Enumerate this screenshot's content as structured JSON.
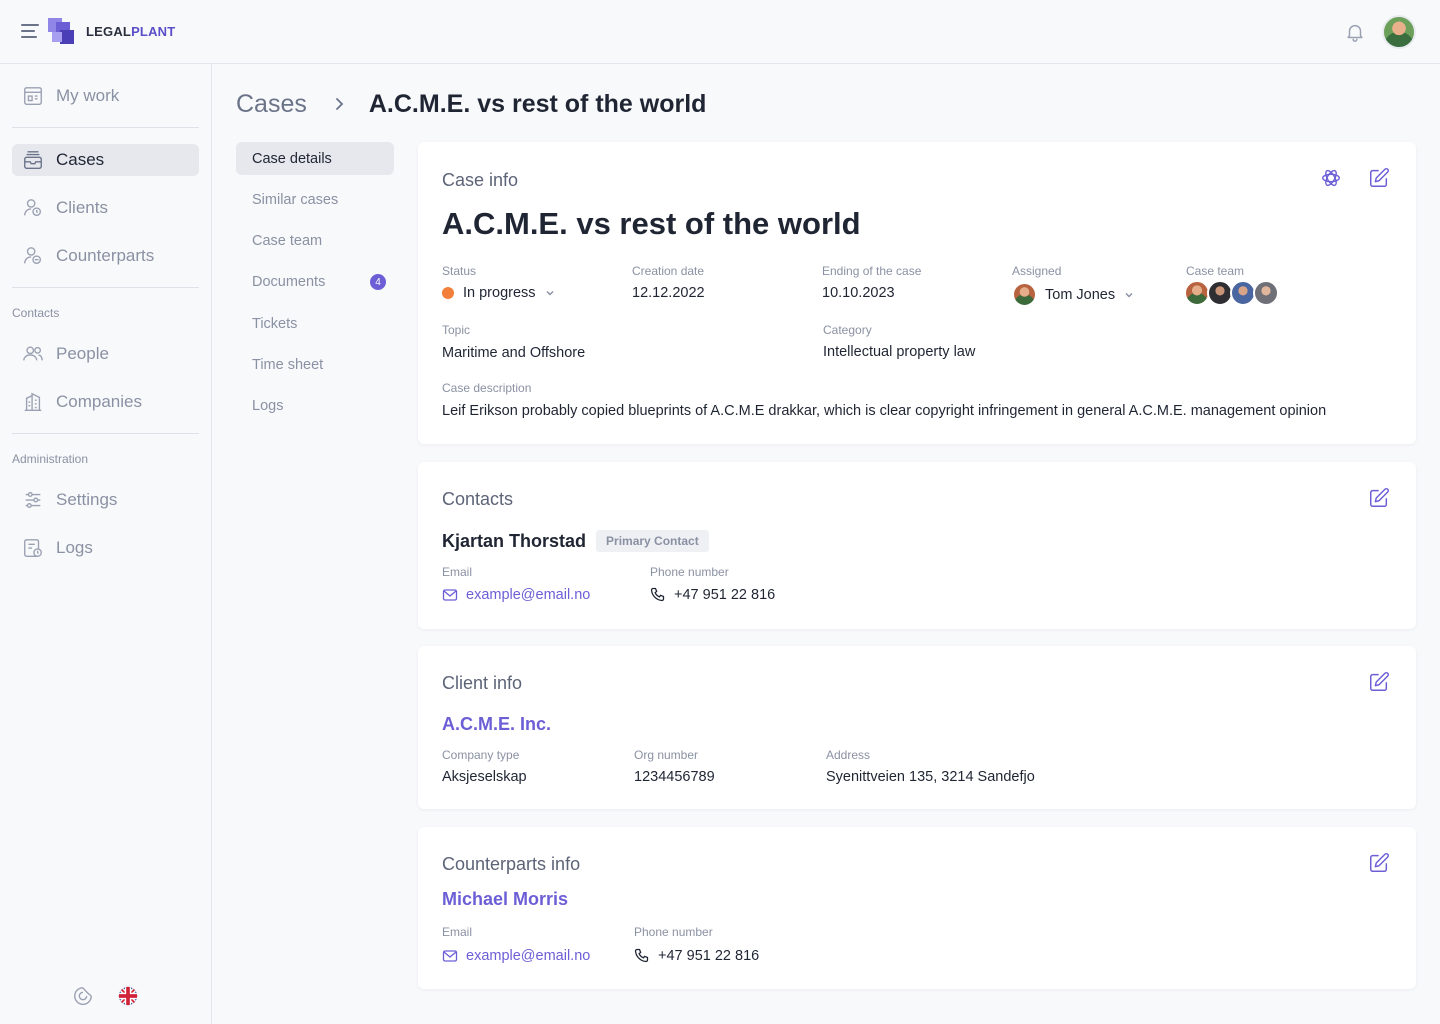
{
  "brand": {
    "name_part1": "LEGAL",
    "name_part2": "PLANT"
  },
  "colors": {
    "accent": "#6c5fd6",
    "status_in_progress": "#f2803a"
  },
  "sidebar": {
    "items": [
      {
        "id": "my-work",
        "label": "My work",
        "icon": "my-work-icon"
      },
      {
        "id": "cases",
        "label": "Cases",
        "icon": "cases-icon",
        "active": true
      },
      {
        "id": "clients",
        "label": "Clients",
        "icon": "clients-icon"
      },
      {
        "id": "counterparts",
        "label": "Counterparts",
        "icon": "counterparts-icon"
      },
      {
        "id": "people",
        "label": "People",
        "icon": "people-icon"
      },
      {
        "id": "companies",
        "label": "Companies",
        "icon": "companies-icon"
      },
      {
        "id": "settings",
        "label": "Settings",
        "icon": "settings-icon"
      },
      {
        "id": "logs",
        "label": "Logs",
        "icon": "logs-icon"
      }
    ],
    "sections": {
      "contacts": "Contacts",
      "administration": "Administration"
    },
    "bottom_icons": [
      "theme-icon",
      "uk-flag-icon"
    ]
  },
  "header": {
    "breadcrumb_root": "Cases",
    "breadcrumb_current": "A.C.M.E. vs rest of the world"
  },
  "subnav": {
    "items": [
      {
        "label": "Case details",
        "active": true
      },
      {
        "label": "Similar cases"
      },
      {
        "label": "Case team"
      },
      {
        "label": "Documents",
        "badge": "4"
      },
      {
        "label": "Tickets"
      },
      {
        "label": "Time sheet"
      },
      {
        "label": "Logs"
      }
    ]
  },
  "case_info": {
    "title": "Case info",
    "case_name": "A.C.M.E. vs rest of the world",
    "status_label": "Status",
    "status_value": "In progress",
    "creation_label": "Creation date",
    "creation_value": "12.12.2022",
    "ending_label": "Ending of the case",
    "ending_value": "10.10.2023",
    "assigned_label": "Assigned",
    "assigned_value": "Tom Jones",
    "team_label": "Case team",
    "topic_label": "Topic",
    "topic_value": "Maritime and Offshore",
    "category_label": "Category",
    "category_value": "Intellectual property law",
    "description_label": "Case description",
    "description_value": "Leif Erikson probably copied blueprints of A.C.M.E drakkar, which is clear copyright infringement in general A.C.M.E. management opinion"
  },
  "contacts": {
    "title": "Contacts",
    "name": "Kjartan Thorstad",
    "chip": "Primary Contact",
    "email_label": "Email",
    "email_value": "example@email.no",
    "phone_label": "Phone number",
    "phone_value": "+47 951 22 816"
  },
  "client_info": {
    "title": "Client info",
    "name": "A.C.M.E. Inc.",
    "type_label": "Company type",
    "type_value": "Aksjeselskap",
    "org_label": "Org number",
    "org_value": "1234456789",
    "address_label": "Address",
    "address_value": "Syenittveien 135, 3214 Sandefjo"
  },
  "counterparts_info": {
    "title": "Counterparts info",
    "name": "Michael Morris",
    "email_label": "Email",
    "email_value": "example@email.no",
    "phone_label": "Phone number",
    "phone_value": "+47 951 22 816"
  }
}
